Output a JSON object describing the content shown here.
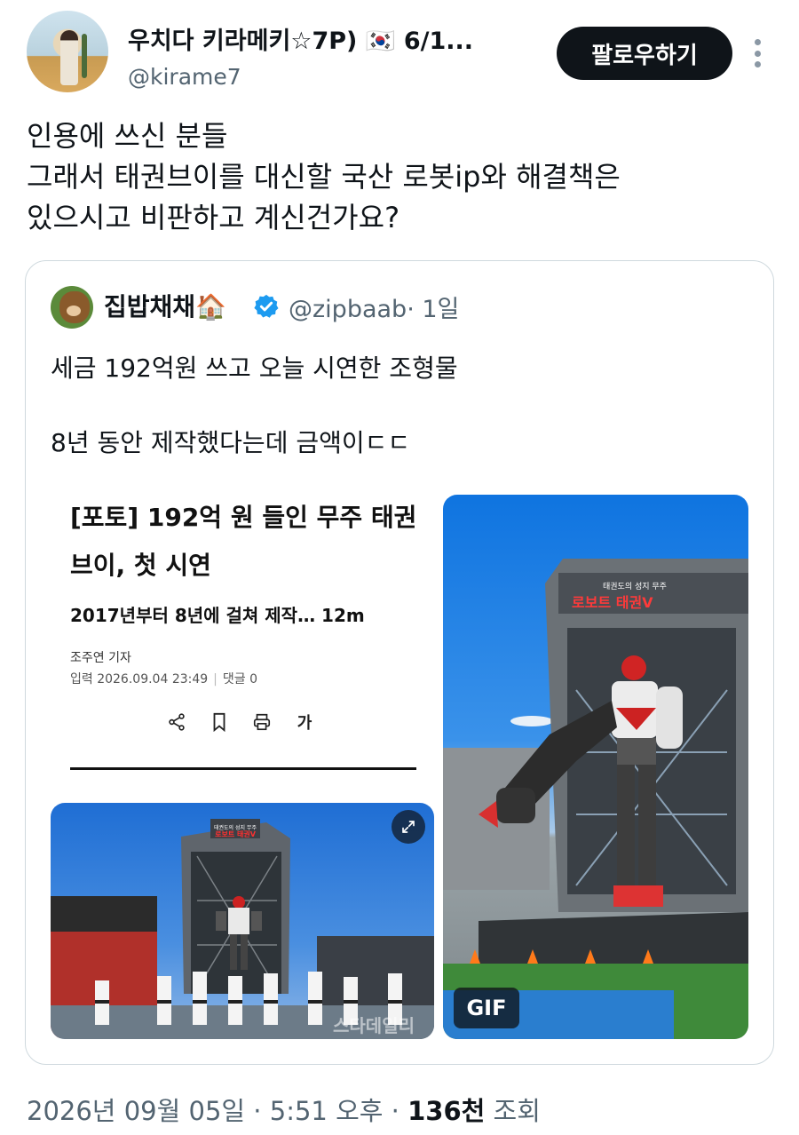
{
  "author": {
    "display_name": "우치다 키라메키☆7P) 🇰🇷 6/1...",
    "handle": "@kirame7",
    "follow_label": "팔로우하기"
  },
  "tweet": {
    "lines": [
      "인용에 쓰신 분들",
      "그래서 태권브이를 대신할 국산 로봇ip와 해결책은",
      "있으시고 비판하고 계신건가요?"
    ]
  },
  "quote": {
    "name": "집밥채채🏠",
    "handle": "@zipbaab",
    "time": "· 1일",
    "lines": [
      "세금 192억원 쓰고 오늘 시연한 조형물",
      "",
      "8년 동안 제작했다는데 금액이ㄷㄷ"
    ],
    "article": {
      "title": "[포토] 192억 원 들인 무주 태권브이, 첫 시연",
      "subtitle": "2017년부터 8년에 걸쳐 제작… 12m",
      "author": "조주연 기자",
      "date": "입력 2026.09.04 23:49",
      "comments": "댓글 0",
      "font_icon_label": "가"
    },
    "photos": {
      "left_sign": "태권도의 성지 무주",
      "left_sign_main": "로보트 태권V",
      "left_watermark": "스타데일리",
      "right_sign": "태권도의 성지 무주",
      "right_sign_main": "로보트 태권V",
      "gif_label": "GIF"
    }
  },
  "footer": {
    "date": "2026년 09월 05일 · 5:51 오후 · ",
    "views_count": "136천",
    "views_label": " 조회"
  }
}
